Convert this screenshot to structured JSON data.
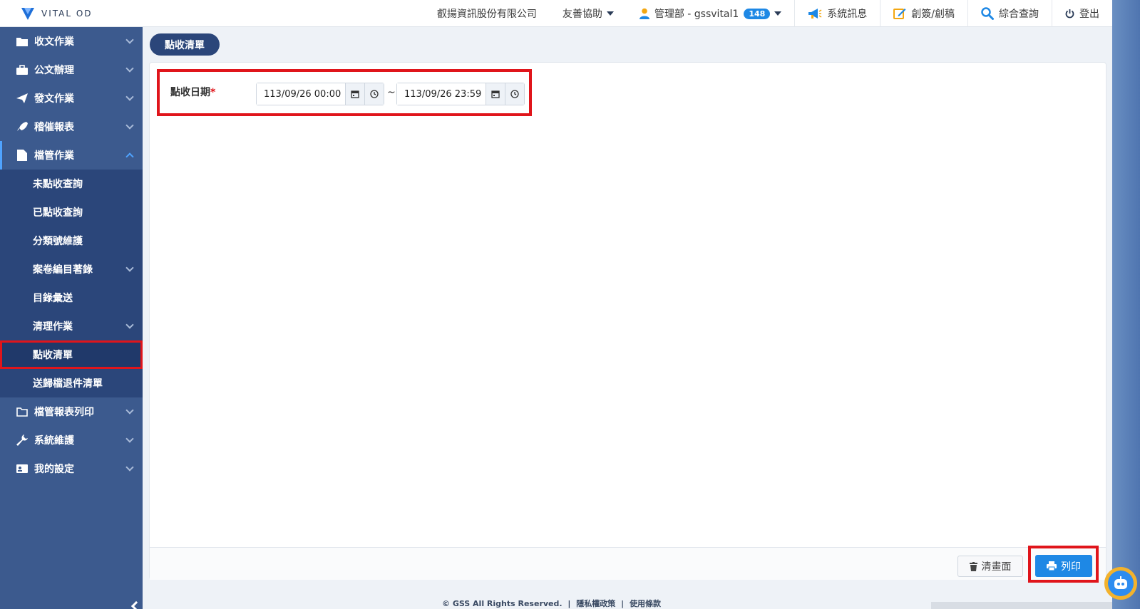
{
  "header": {
    "logo_text": "VITAL OD",
    "company": "叡揚資訊股份有限公司",
    "accessibility": "友善協助",
    "user": "管理部 - gssvital1",
    "user_badge": "148",
    "system_messages": "系統訊息",
    "create_draft": "創簽/創稿",
    "search": "綜合查詢",
    "logout": "登出"
  },
  "sidebar": {
    "items": [
      {
        "label": "收文作業",
        "icon": "folder-icon"
      },
      {
        "label": "公文辦理",
        "icon": "briefcase-icon"
      },
      {
        "label": "發文作業",
        "icon": "send-icon"
      },
      {
        "label": "稽催報表",
        "icon": "rocket-icon"
      },
      {
        "label": "檔管作業",
        "icon": "file-icon"
      }
    ],
    "sub_items": [
      {
        "label": "未點收查詢"
      },
      {
        "label": "已點收查詢"
      },
      {
        "label": "分類號維護"
      },
      {
        "label": "案卷編目著錄"
      },
      {
        "label": "目錄彙送"
      },
      {
        "label": "清理作業"
      },
      {
        "label": "點收清單"
      },
      {
        "label": "送歸檔退件清單"
      }
    ],
    "bottom_items": [
      {
        "label": "檔管報表列印",
        "icon": "folder-open-icon"
      },
      {
        "label": "系統維護",
        "icon": "wrench-icon"
      },
      {
        "label": "我的設定",
        "icon": "id-card-icon"
      }
    ]
  },
  "main": {
    "page_title": "點收清單",
    "field_label": "點收日期",
    "required_mark": "*",
    "start_datetime": "113/09/26 00:00",
    "tilde": "~",
    "end_datetime": "113/09/26 23:59",
    "clear_button": "清畫面",
    "print_button": "列印"
  },
  "footer": {
    "copyright": "© GSS All Rights Reserved.",
    "sep": "|",
    "privacy": "隱私權政策",
    "terms": "使用條款"
  },
  "colors": {
    "sidebar_bg": "#3c5a8e",
    "sidebar_sub_bg": "#2b467a",
    "primary": "#1e88e5",
    "highlight": "#e0151b"
  }
}
